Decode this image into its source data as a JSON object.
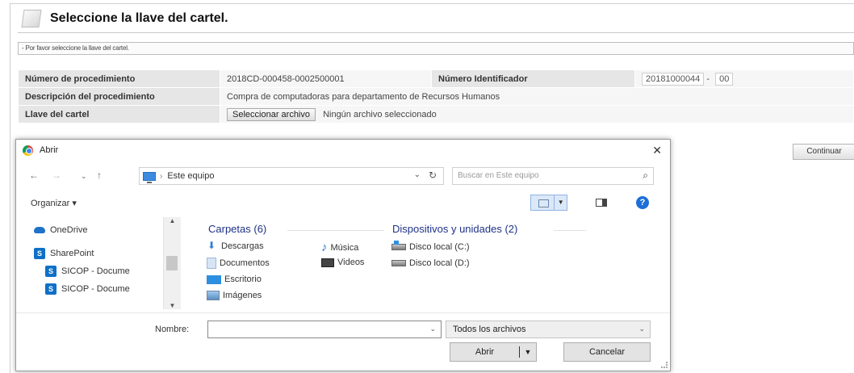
{
  "page": {
    "title": "Seleccione la llave del cartel.",
    "notice": "- Por favor seleccione la llave del cartel.",
    "rows": {
      "procedimiento_label": "Número de procedimiento",
      "procedimiento_value": "2018CD-000458-0002500001",
      "identificador_label": "Número Identificador",
      "identificador_value": "20181000044",
      "identificador_sep": "-",
      "identificador_suffix": "00",
      "descripcion_label": "Descripción del procedimiento",
      "descripcion_value": "Compra de computadoras para departamento de Recursos Humanos",
      "llave_label": "Llave del cartel",
      "file_button": "Seleccionar archivo",
      "file_status": "Ningún archivo seleccionado"
    },
    "continue_label": "Continuar"
  },
  "dialog": {
    "title": "Abrir",
    "close": "✕",
    "address": {
      "separator": "›",
      "location": "Este equipo",
      "dropdown": "⌄",
      "refresh": "↻"
    },
    "search_placeholder": "Buscar en Este equipo",
    "search_icon": "⌕",
    "organize_label": "Organizar ▾",
    "help": "?",
    "nav_arrows": {
      "back": "←",
      "forward": "→",
      "recent": "⌄",
      "up": "↑"
    },
    "nav_pane": [
      {
        "label": "OneDrive",
        "icon": "cloud-icon"
      },
      {
        "label": "SharePoint",
        "icon": "sharepoint-icon"
      },
      {
        "label": "SICOP - Docume",
        "icon": "sharepoint-icon"
      },
      {
        "label": "SICOP - Docume",
        "icon": "sharepoint-icon"
      }
    ],
    "folders_title": "Carpetas (6)",
    "folders": [
      {
        "label": "Descargas",
        "icon": "download-icon"
      },
      {
        "label": "Documentos",
        "icon": "documents-icon"
      },
      {
        "label": "Escritorio",
        "icon": "desktop-icon"
      },
      {
        "label": "Imágenes",
        "icon": "pictures-icon"
      },
      {
        "label": "Música",
        "icon": "music-icon"
      },
      {
        "label": "Videos",
        "icon": "videos-icon"
      }
    ],
    "devices_title": "Dispositivos y unidades (2)",
    "devices": [
      {
        "label": "Disco local (C:)",
        "icon": "disk-c-icon"
      },
      {
        "label": "Disco local (D:)",
        "icon": "disk-d-icon"
      }
    ],
    "name_label": "Nombre:",
    "name_value": "",
    "file_type": "Todos los archivos",
    "open_label": "Abrir",
    "cancel_label": "Cancelar"
  }
}
